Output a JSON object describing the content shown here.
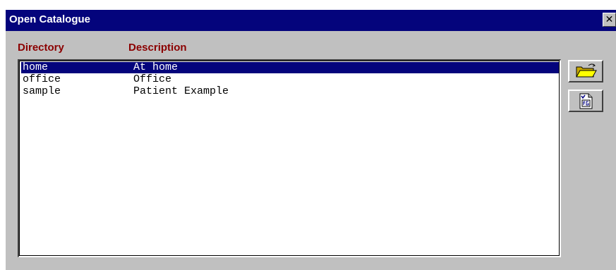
{
  "window": {
    "title": "Open Catalogue",
    "close_glyph": "✕"
  },
  "columns": {
    "directory": "Directory",
    "description": "Description"
  },
  "rows": [
    {
      "directory": "home",
      "description": "At home",
      "selected": true
    },
    {
      "directory": "office",
      "description": "Office",
      "selected": false
    },
    {
      "directory": "sample",
      "description": "Patient Example",
      "selected": false
    }
  ],
  "toolbar": {
    "open_icon": "open-folder-icon",
    "file_icon": "catalogue-file-icon"
  },
  "colors": {
    "titlebar": "#04047c",
    "selection": "#04047c",
    "header_text": "#8b0000",
    "face": "#c0c0c0"
  }
}
